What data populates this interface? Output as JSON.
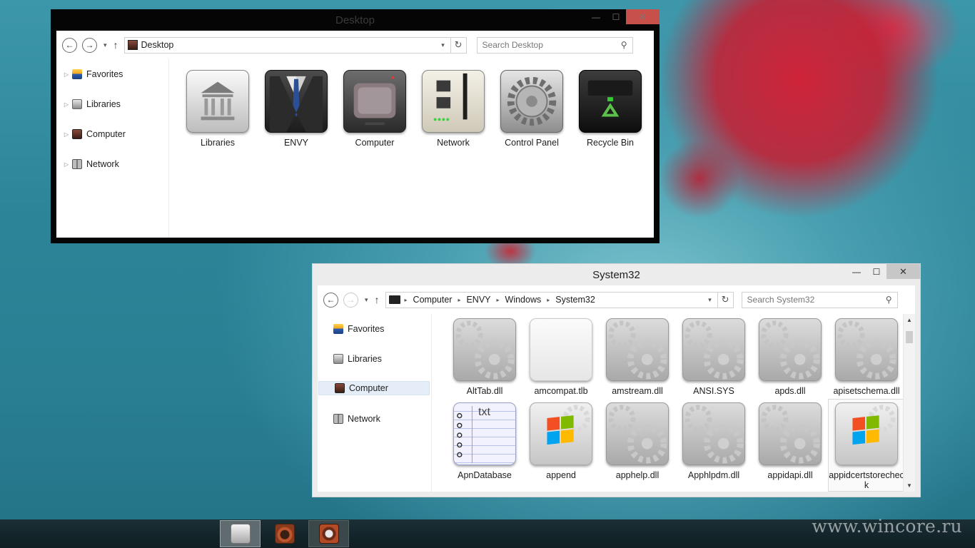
{
  "desktop_window": {
    "title": "Desktop",
    "caption": {
      "minimize": "—",
      "maximize": "☐",
      "close": "✕"
    },
    "nav": {
      "back": "←",
      "forward": "→",
      "dropdown": "▾",
      "up": "↑"
    },
    "address": {
      "crumbs": [
        "Desktop"
      ],
      "dropdown": "▾",
      "refresh": "↻"
    },
    "search": {
      "placeholder": "Search Desktop",
      "icon": "search-icon"
    },
    "nav_pane": [
      {
        "label": "Favorites",
        "icon": "favorites-icon"
      },
      {
        "label": "Libraries",
        "icon": "libraries-icon"
      },
      {
        "label": "Computer",
        "icon": "computer-icon"
      },
      {
        "label": "Network",
        "icon": "network-icon"
      }
    ],
    "items": [
      {
        "label": "Libraries",
        "icon": "library-icon"
      },
      {
        "label": "ENVY",
        "icon": "user-suit-icon"
      },
      {
        "label": "Computer",
        "icon": "tv-computer-icon"
      },
      {
        "label": "Network",
        "icon": "network-switch-icon"
      },
      {
        "label": "Control Panel",
        "icon": "gear-icon"
      },
      {
        "label": "Recycle Bin",
        "icon": "recycle-bin-icon"
      }
    ]
  },
  "system32_window": {
    "title": "System32",
    "caption": {
      "minimize": "—",
      "maximize": "☐",
      "close": "✕"
    },
    "nav": {
      "back": "←",
      "forward": "→",
      "dropdown": "▾",
      "up": "↑"
    },
    "address": {
      "crumbs": [
        "Computer",
        "ENVY",
        "Windows",
        "System32"
      ],
      "separator": "▸",
      "dropdown": "▾",
      "refresh": "↻"
    },
    "search": {
      "placeholder": "Search System32",
      "icon": "search-icon"
    },
    "nav_pane": [
      {
        "label": "Favorites",
        "icon": "favorites-icon",
        "selected": false
      },
      {
        "label": "Libraries",
        "icon": "libraries-icon",
        "selected": false
      },
      {
        "label": "Computer",
        "icon": "computer-icon",
        "selected": true
      },
      {
        "label": "Network",
        "icon": "network-icon",
        "selected": false
      }
    ],
    "items": [
      {
        "label": "AltTab.dll",
        "icon": "dll-gear-icon"
      },
      {
        "label": "amcompat.tlb",
        "icon": "blank-file-icon"
      },
      {
        "label": "amstream.dll",
        "icon": "dll-gear-icon"
      },
      {
        "label": "ANSI.SYS",
        "icon": "dll-gear-icon"
      },
      {
        "label": "apds.dll",
        "icon": "dll-gear-icon"
      },
      {
        "label": "apisetschema.dll",
        "icon": "dll-gear-icon"
      },
      {
        "label": "ApnDatabase",
        "icon": "txt-notebook-icon"
      },
      {
        "label": "append",
        "icon": "windows-app-icon"
      },
      {
        "label": "apphelp.dll",
        "icon": "dll-gear-icon"
      },
      {
        "label": "Apphlpdm.dll",
        "icon": "dll-gear-icon"
      },
      {
        "label": "appidapi.dll",
        "icon": "dll-gear-icon"
      },
      {
        "label": "appidcertstorecheck",
        "icon": "windows-app-icon",
        "selected": true
      }
    ],
    "txt_icon_text": "txt",
    "scrollbar": {
      "up": "▲",
      "down": "▼"
    }
  },
  "taskbar": {
    "buttons": [
      {
        "name": "file-explorer-library",
        "state": "active"
      },
      {
        "name": "media-player",
        "state": "idle"
      },
      {
        "name": "control-panel",
        "state": "open"
      }
    ]
  },
  "watermark": "www.wincore.ru",
  "colors": {
    "close_red": "#c7504b",
    "selected_blue": "#e5eef8"
  }
}
